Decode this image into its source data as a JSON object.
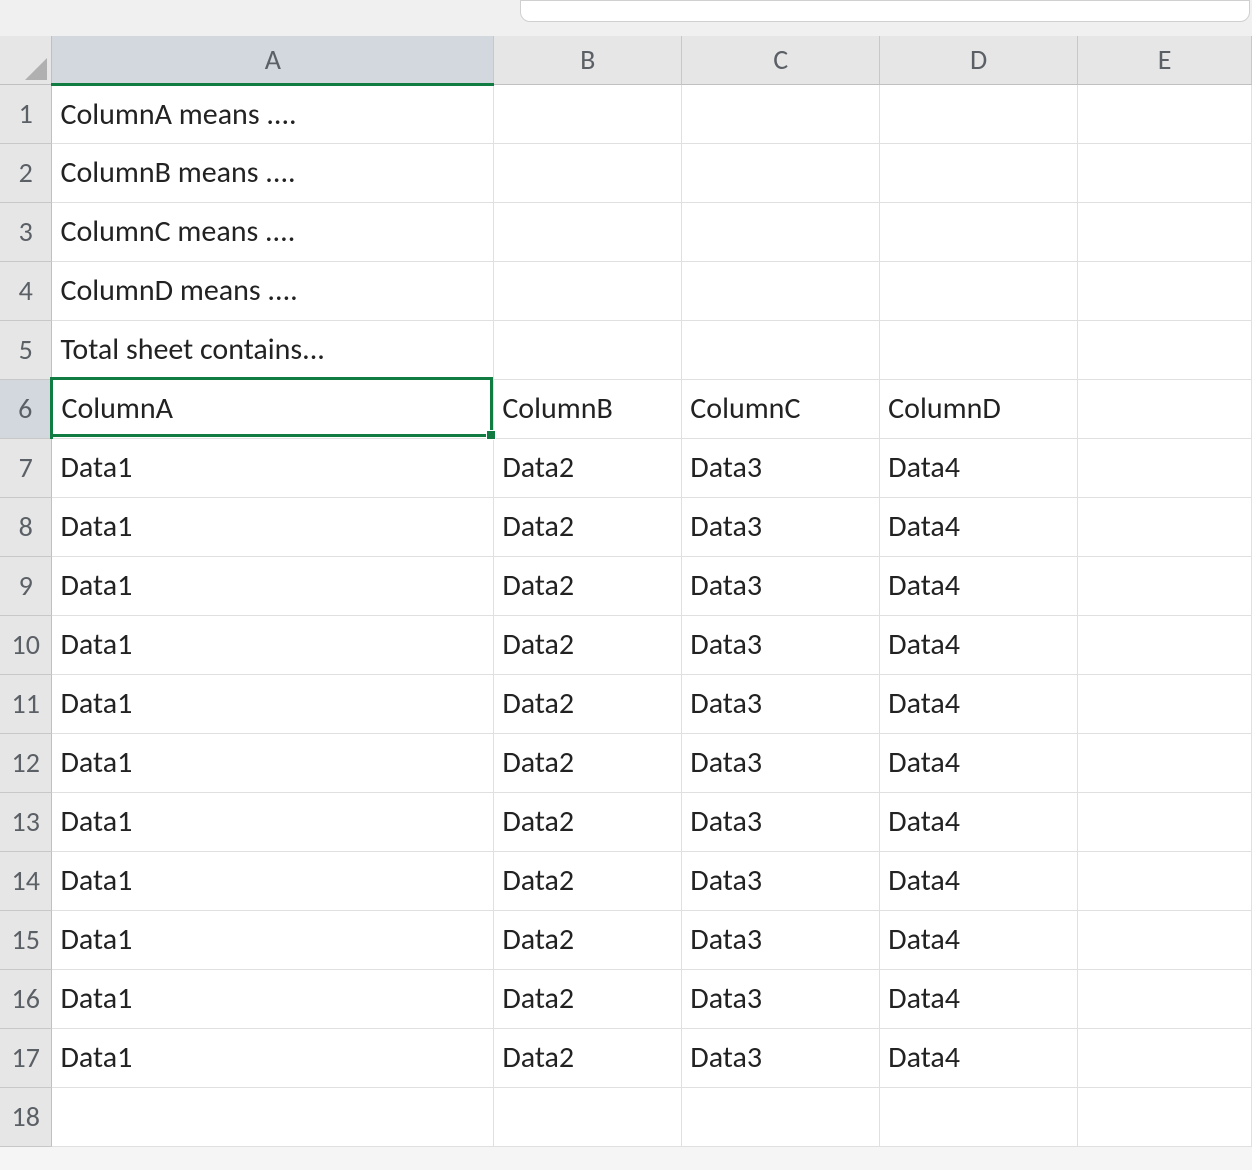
{
  "columns": [
    "A",
    "B",
    "C",
    "D",
    "E"
  ],
  "rowCount": 18,
  "selectedCell": {
    "row": 6,
    "col": "A"
  },
  "cells": {
    "1": {
      "A": "ColumnA means ....",
      "B": "",
      "C": "",
      "D": "",
      "E": ""
    },
    "2": {
      "A": "ColumnB means ....",
      "B": "",
      "C": "",
      "D": "",
      "E": ""
    },
    "3": {
      "A": "ColumnC means ....",
      "B": "",
      "C": "",
      "D": "",
      "E": ""
    },
    "4": {
      "A": "ColumnD means ....",
      "B": "",
      "C": "",
      "D": "",
      "E": ""
    },
    "5": {
      "A": "Total sheet contains...",
      "B": "",
      "C": "",
      "D": "",
      "E": ""
    },
    "6": {
      "A": "ColumnA",
      "B": "ColumnB",
      "C": "ColumnC",
      "D": "ColumnD",
      "E": ""
    },
    "7": {
      "A": "Data1",
      "B": "Data2",
      "C": "Data3",
      "D": "Data4",
      "E": ""
    },
    "8": {
      "A": "Data1",
      "B": "Data2",
      "C": "Data3",
      "D": "Data4",
      "E": ""
    },
    "9": {
      "A": "Data1",
      "B": "Data2",
      "C": "Data3",
      "D": "Data4",
      "E": ""
    },
    "10": {
      "A": "Data1",
      "B": "Data2",
      "C": "Data3",
      "D": "Data4",
      "E": ""
    },
    "11": {
      "A": "Data1",
      "B": "Data2",
      "C": "Data3",
      "D": "Data4",
      "E": ""
    },
    "12": {
      "A": "Data1",
      "B": "Data2",
      "C": "Data3",
      "D": "Data4",
      "E": ""
    },
    "13": {
      "A": "Data1",
      "B": "Data2",
      "C": "Data3",
      "D": "Data4",
      "E": ""
    },
    "14": {
      "A": "Data1",
      "B": "Data2",
      "C": "Data3",
      "D": "Data4",
      "E": ""
    },
    "15": {
      "A": "Data1",
      "B": "Data2",
      "C": "Data3",
      "D": "Data4",
      "E": ""
    },
    "16": {
      "A": "Data1",
      "B": "Data2",
      "C": "Data3",
      "D": "Data4",
      "E": ""
    },
    "17": {
      "A": "Data1",
      "B": "Data2",
      "C": "Data3",
      "D": "Data4",
      "E": ""
    },
    "18": {
      "A": "",
      "B": "",
      "C": "",
      "D": "",
      "E": ""
    }
  }
}
